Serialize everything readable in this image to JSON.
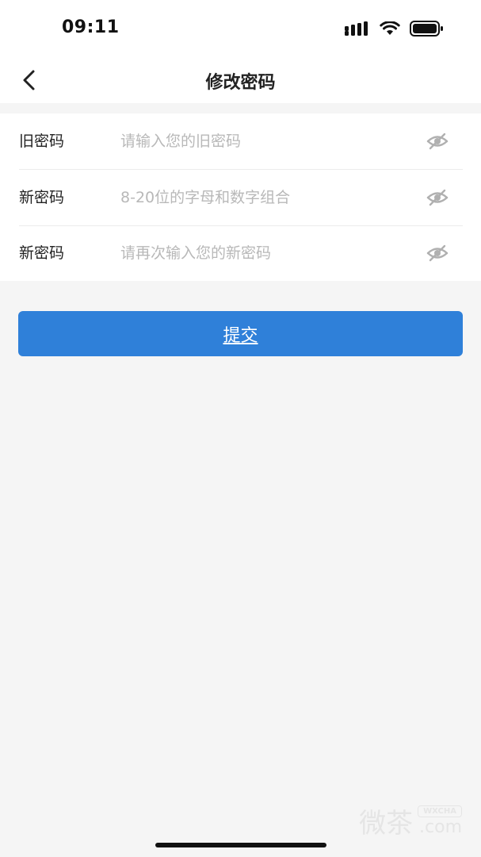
{
  "status_bar": {
    "time": "09:11",
    "icons": [
      "signal-icon",
      "wifi-icon",
      "battery-icon"
    ]
  },
  "nav": {
    "title": "修改密码",
    "back_icon": "chevron-left-icon"
  },
  "form": {
    "fields": [
      {
        "label": "旧密码",
        "value": "",
        "placeholder": "请输入您的旧密码",
        "icon": "eye-off-icon"
      },
      {
        "label": "新密码",
        "value": "",
        "placeholder": "8-20位的字母和数字组合",
        "icon": "eye-off-icon"
      },
      {
        "label": "新密码",
        "value": "",
        "placeholder": "请再次输入您的新密码",
        "icon": "eye-off-icon"
      }
    ]
  },
  "submit": {
    "label": "提交"
  },
  "watermark": {
    "text": "微茶",
    "badge": "WXCHA",
    "domain": ".com"
  },
  "colors": {
    "primary": "#2f80d9",
    "background": "#f5f5f5",
    "surface": "#ffffff",
    "placeholder": "#b8b8b8",
    "icon": "#b0b0b0"
  }
}
